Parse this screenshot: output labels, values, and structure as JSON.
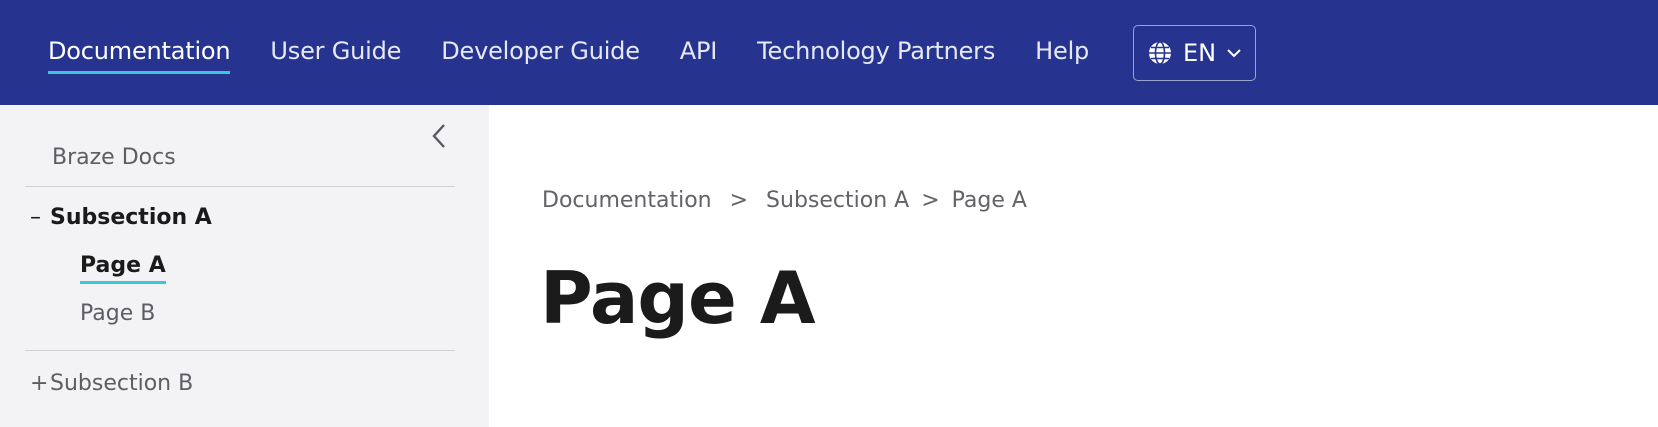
{
  "topnav": {
    "links": [
      {
        "label": "Documentation",
        "active": true
      },
      {
        "label": "User Guide"
      },
      {
        "label": "Developer Guide"
      },
      {
        "label": "API"
      },
      {
        "label": "Technology Partners"
      },
      {
        "label": "Help"
      }
    ],
    "language": {
      "label": "EN",
      "icon": "globe-icon",
      "chevron": "chevron-down-icon"
    }
  },
  "sidebar": {
    "collapse_icon": "chevron-left-icon",
    "root": "Braze Docs",
    "sections": [
      {
        "expand_mark": "–",
        "label": "Subsection A",
        "expanded": true,
        "pages": [
          {
            "label": "Page A",
            "active": true
          },
          {
            "label": "Page B"
          }
        ]
      },
      {
        "expand_mark": "+",
        "label": "Subsection B",
        "expanded": false
      }
    ]
  },
  "main": {
    "breadcrumb": [
      "Documentation",
      "Subsection A",
      "Page A"
    ],
    "breadcrumb_separator": ">",
    "title": "Page A"
  },
  "colors": {
    "nav_bg": "#26348f",
    "accent": "#3cc6d8",
    "sidebar_bg": "#f3f3f5"
  }
}
